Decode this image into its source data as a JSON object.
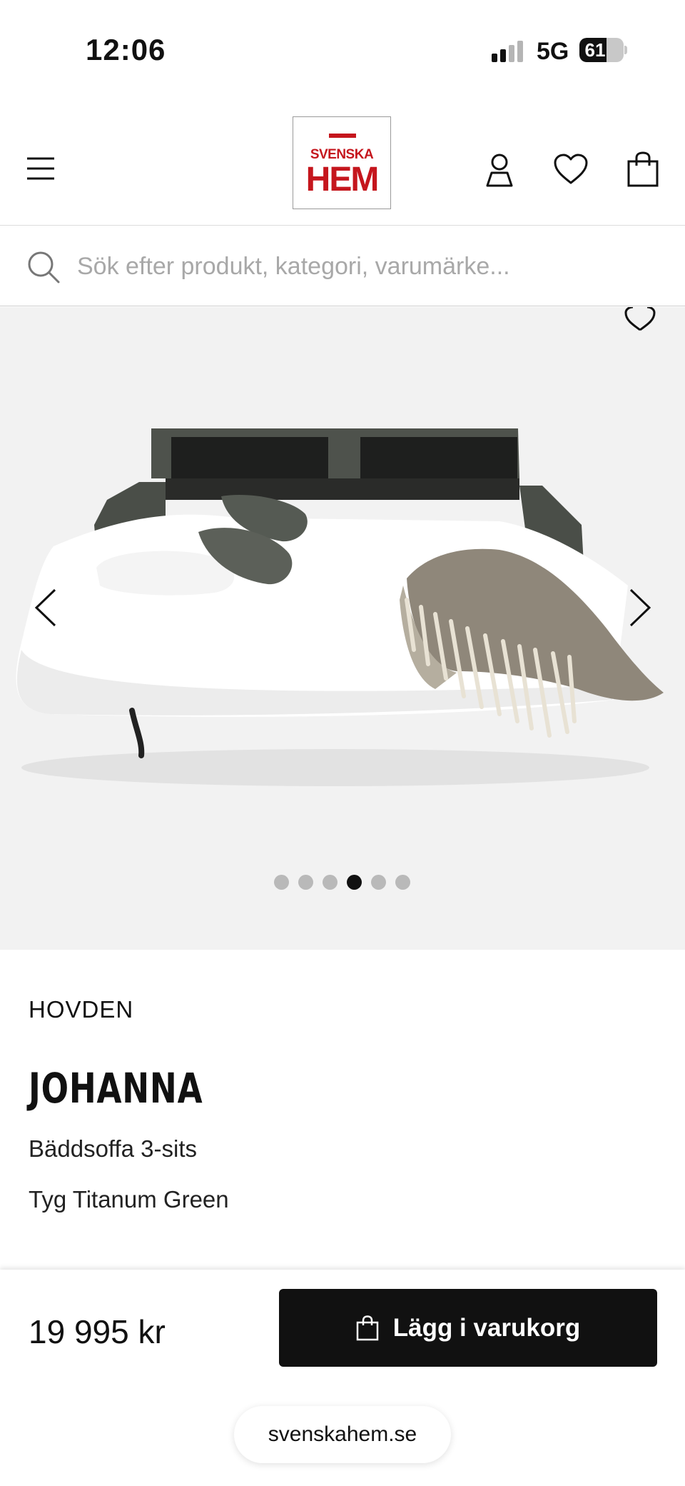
{
  "status_bar": {
    "time": "12:06",
    "network": "5G",
    "battery_level": "61",
    "battery_fraction": 0.61
  },
  "header": {
    "logo": {
      "line1": "SVENSKA",
      "line2": "HEM",
      "brand_color": "#c5161d"
    },
    "icons": [
      "menu-icon",
      "account-icon",
      "wishlist-icon",
      "cart-icon"
    ]
  },
  "search": {
    "placeholder": "Sök efter produkt, kategori, varumärke..."
  },
  "gallery": {
    "image_count": 6,
    "active_index": 3,
    "icons": [
      "wishlist-icon",
      "chevron-left-icon",
      "chevron-right-icon"
    ]
  },
  "product": {
    "brand": "HOVDEN",
    "name": "JOHANNA",
    "subtitle": "Bäddsoffa 3-sits",
    "variant": "Tyg Titanum Green"
  },
  "buy_bar": {
    "price": "19 995 kr",
    "add_to_cart_label": "Lägg i varukorg",
    "button_color": "#111111"
  },
  "browser": {
    "url": "svenskahem.se"
  }
}
